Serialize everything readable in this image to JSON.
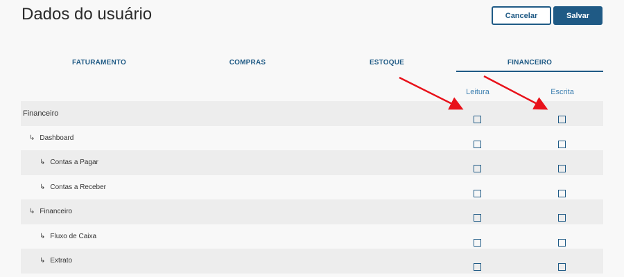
{
  "page": {
    "title": "Dados do usuário"
  },
  "actions": {
    "cancel_label": "Cancelar",
    "save_label": "Salvar"
  },
  "tabs": [
    {
      "label": "FATURAMENTO",
      "active": false
    },
    {
      "label": "COMPRAS",
      "active": false
    },
    {
      "label": "ESTOQUE",
      "active": false
    },
    {
      "label": "FINANCEIRO",
      "active": true
    }
  ],
  "columns": {
    "read": "Leitura",
    "write": "Escrita"
  },
  "permissions": [
    {
      "label": "Financeiro",
      "level": 0,
      "read": false,
      "write": false
    },
    {
      "label": "Dashboard",
      "level": 1,
      "read": false,
      "write": false
    },
    {
      "label": "Contas a Pagar",
      "level": 2,
      "read": false,
      "write": false
    },
    {
      "label": "Contas a Receber",
      "level": 2,
      "read": false,
      "write": false
    },
    {
      "label": "Financeiro",
      "level": 1,
      "read": false,
      "write": false
    },
    {
      "label": "Fluxo de Caixa",
      "level": 2,
      "read": false,
      "write": false
    },
    {
      "label": "Extrato",
      "level": 2,
      "read": false,
      "write": false
    }
  ],
  "colors": {
    "accent": "#1f5a85",
    "annotation": "#e8111a",
    "row_shade": "#ededed"
  }
}
